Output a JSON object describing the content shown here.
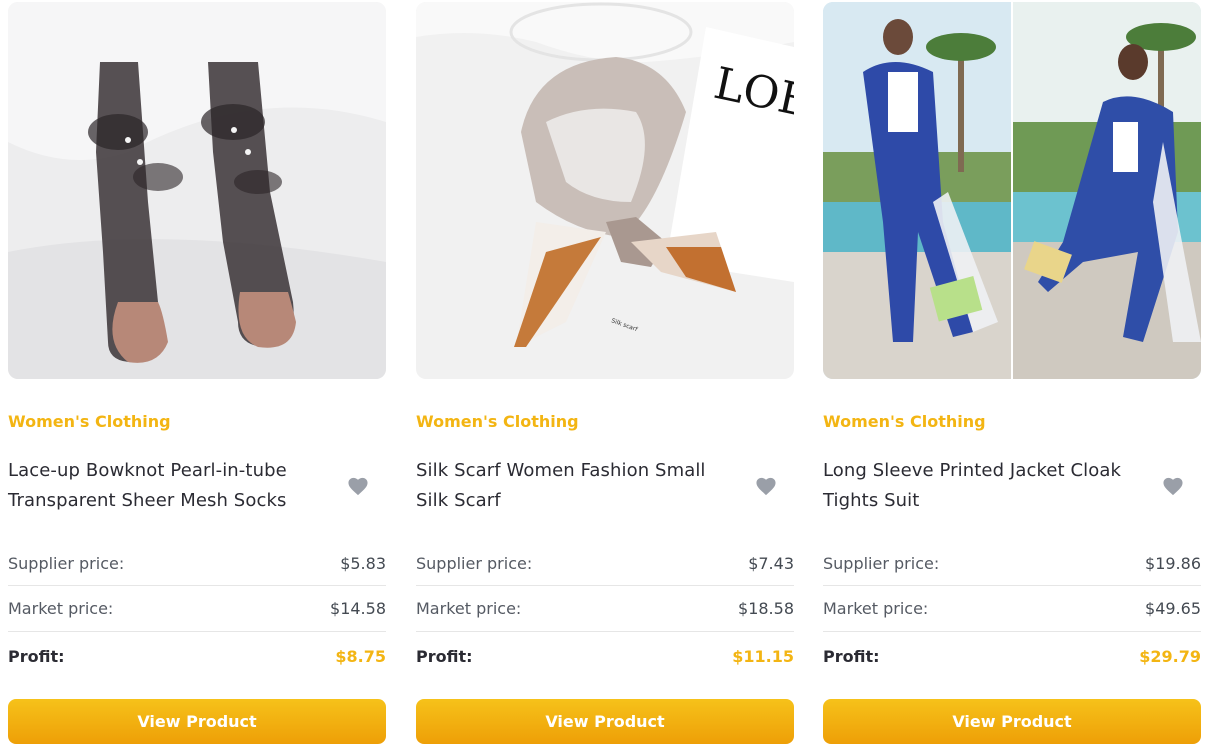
{
  "products": [
    {
      "category": "Women's Clothing",
      "title": "Lace-up Bowknot Pearl-in-tube Transparent Sheer Mesh Socks",
      "supplier_label": "Supplier price:",
      "supplier_price": "$5.83",
      "market_label": "Market price:",
      "market_price": "$14.58",
      "profit_label": "Profit:",
      "profit": "$8.75",
      "button_label": "View Product"
    },
    {
      "category": "Women's Clothing",
      "title": "Silk Scarf Women Fashion Small Silk Scarf",
      "supplier_label": "Supplier price:",
      "supplier_price": "$7.43",
      "market_label": "Market price:",
      "market_price": "$18.58",
      "profit_label": "Profit:",
      "profit": "$11.15",
      "button_label": "View Product",
      "image_text": "LOE"
    },
    {
      "category": "Women's Clothing",
      "title": "Long Sleeve Printed Jacket Cloak Tights Suit",
      "supplier_label": "Supplier price:",
      "supplier_price": "$19.86",
      "market_label": "Market price:",
      "market_price": "$49.65",
      "profit_label": "Profit:",
      "profit": "$29.79",
      "button_label": "View Product"
    }
  ],
  "colors": {
    "accent": "#f3b513",
    "button_start": "#f6c21a",
    "button_end": "#ee9f07",
    "heart": "#9a9fa8"
  },
  "icons": {
    "favorite": "heart-icon"
  }
}
